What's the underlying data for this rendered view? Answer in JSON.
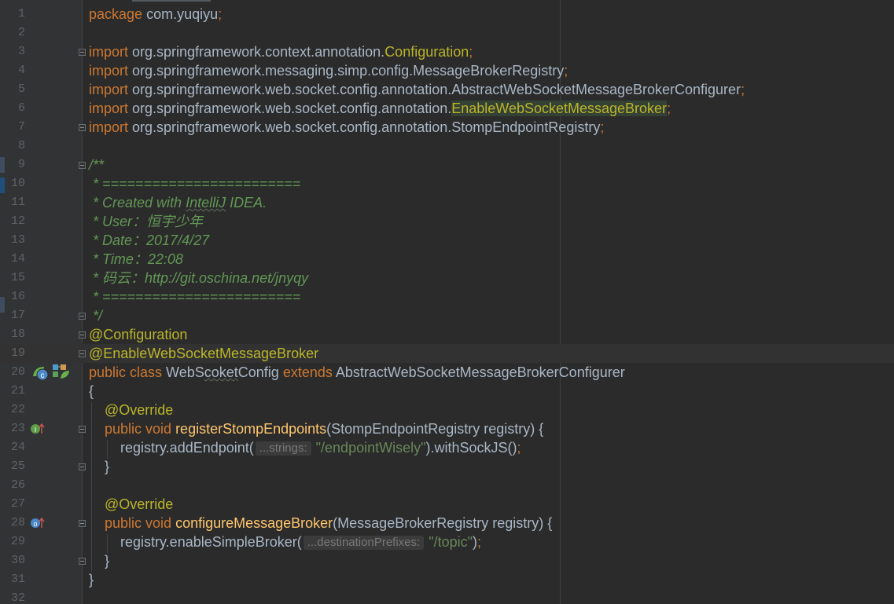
{
  "editor": {
    "lines": [
      {
        "n": "1",
        "tokens": [
          {
            "t": "package",
            "c": "kw"
          },
          {
            "t": " com.yuqiyu",
            "c": "plain"
          },
          {
            "t": ";",
            "c": "semi"
          }
        ]
      },
      {
        "n": "2",
        "tokens": []
      },
      {
        "n": "3",
        "tokens": [
          {
            "t": "import",
            "c": "kw"
          },
          {
            "t": " org.springframework.context.annotation.",
            "c": "plain"
          },
          {
            "t": "Configuration",
            "c": "annimp"
          },
          {
            "t": ";",
            "c": "semi"
          }
        ]
      },
      {
        "n": "4",
        "tokens": [
          {
            "t": "import",
            "c": "kw"
          },
          {
            "t": " org.springframework.messaging.simp.config.MessageBrokerRegistry",
            "c": "plain"
          },
          {
            "t": ";",
            "c": "semi"
          }
        ]
      },
      {
        "n": "5",
        "tokens": [
          {
            "t": "import",
            "c": "kw"
          },
          {
            "t": " org.springframework.web.socket.config.annotation.AbstractWebSocketMessageBrokerConfigurer",
            "c": "plain"
          },
          {
            "t": ";",
            "c": "semi"
          }
        ]
      },
      {
        "n": "6",
        "tokens": [
          {
            "t": "import",
            "c": "kw"
          },
          {
            "t": " org.springframework.web.socket.config.annotation.",
            "c": "plain"
          },
          {
            "t": "EnableWebSocketMessageBroker",
            "c": "annimp hl"
          },
          {
            "t": ";",
            "c": "semi"
          }
        ]
      },
      {
        "n": "7",
        "tokens": [
          {
            "t": "import",
            "c": "kw"
          },
          {
            "t": " org.springframework.web.socket.config.annotation.StompEndpointRegistry",
            "c": "plain"
          },
          {
            "t": ";",
            "c": "semi"
          }
        ]
      },
      {
        "n": "8",
        "tokens": []
      },
      {
        "n": "9",
        "tokens": [
          {
            "t": "/**",
            "c": "doc"
          }
        ]
      },
      {
        "n": "10",
        "tokens": [
          {
            "t": " * ========================",
            "c": "doc"
          }
        ]
      },
      {
        "n": "11",
        "tokens": [
          {
            "t": " * Created with ",
            "c": "doc"
          },
          {
            "t": "IntelliJ",
            "c": "doc typo"
          },
          {
            "t": " IDEA.",
            "c": "doc"
          }
        ]
      },
      {
        "n": "12",
        "tokens": [
          {
            "t": " * User：恒宇少年",
            "c": "doc"
          }
        ]
      },
      {
        "n": "13",
        "tokens": [
          {
            "t": " * Date：2017/4/27",
            "c": "doc"
          }
        ]
      },
      {
        "n": "14",
        "tokens": [
          {
            "t": " * Time：22:08",
            "c": "doc"
          }
        ]
      },
      {
        "n": "15",
        "tokens": [
          {
            "t": " * 码云：http://git.oschina.net/jnyqy",
            "c": "doc"
          }
        ]
      },
      {
        "n": "16",
        "tokens": [
          {
            "t": " * ========================",
            "c": "doc"
          }
        ]
      },
      {
        "n": "17",
        "tokens": [
          {
            "t": " */",
            "c": "doc"
          }
        ]
      },
      {
        "n": "18",
        "tokens": [
          {
            "t": "@Configuration",
            "c": "ann"
          }
        ]
      },
      {
        "n": "19",
        "tokens": [
          {
            "t": "@EnableWebSocketMessageBroker",
            "c": "ann"
          }
        ]
      },
      {
        "n": "20",
        "tokens": [
          {
            "t": "public class ",
            "c": "kw"
          },
          {
            "t": "WebS",
            "c": "plain"
          },
          {
            "t": "coket",
            "c": "plain typo"
          },
          {
            "t": "Config ",
            "c": "plain"
          },
          {
            "t": "extends ",
            "c": "kw"
          },
          {
            "t": "AbstractWebSocketMessageBrokerConfigurer",
            "c": "plain"
          }
        ]
      },
      {
        "n": "21",
        "tokens": [
          {
            "t": "{",
            "c": "plain"
          }
        ]
      },
      {
        "n": "22",
        "tokens": [
          {
            "t": "    @Override",
            "c": "ann"
          }
        ]
      },
      {
        "n": "23",
        "tokens": [
          {
            "t": "    public void ",
            "c": "kw"
          },
          {
            "t": "registerStompEndpoints",
            "c": "fn"
          },
          {
            "t": "(StompEndpointRegistry registry) {",
            "c": "plain"
          }
        ]
      },
      {
        "n": "24",
        "tokens": [
          {
            "t": "        registry.addEndpoint(",
            "c": "plain"
          },
          {
            "t": "...strings:",
            "c": "hint"
          },
          {
            "t": "\"/endpointWisely\"",
            "c": "str"
          },
          {
            "t": ").withSockJS()",
            "c": "plain"
          },
          {
            "t": ";",
            "c": "semi"
          }
        ]
      },
      {
        "n": "25",
        "tokens": [
          {
            "t": "    }",
            "c": "plain"
          }
        ]
      },
      {
        "n": "26",
        "tokens": []
      },
      {
        "n": "27",
        "tokens": [
          {
            "t": "    @Override",
            "c": "ann"
          }
        ]
      },
      {
        "n": "28",
        "tokens": [
          {
            "t": "    public void ",
            "c": "kw"
          },
          {
            "t": "configureMessageBroker",
            "c": "fn"
          },
          {
            "t": "(MessageBrokerRegistry registry) {",
            "c": "plain"
          }
        ]
      },
      {
        "n": "29",
        "tokens": [
          {
            "t": "        registry.enableSimpleBroker(",
            "c": "plain"
          },
          {
            "t": "...destinationPrefixes:",
            "c": "hint"
          },
          {
            "t": "\"/topic\"",
            "c": "str"
          },
          {
            "t": ")",
            "c": "plain"
          },
          {
            "t": ";",
            "c": "semi"
          }
        ]
      },
      {
        "n": "30",
        "tokens": [
          {
            "t": "    }",
            "c": "plain"
          }
        ]
      },
      {
        "n": "31",
        "tokens": [
          {
            "t": "}",
            "c": "plain"
          }
        ]
      },
      {
        "n": "32",
        "tokens": []
      }
    ],
    "gutter_icons": [
      {
        "line": "20",
        "name": "spring-bean-class-icon",
        "color": "#4caf50"
      },
      {
        "line": "20",
        "name": "spring-config-icon",
        "color": "#6a9955"
      },
      {
        "line": "23",
        "name": "implement-method-icon",
        "color": "#6a9955"
      },
      {
        "line": "28",
        "name": "implement-method-icon",
        "color": "#4a88c7"
      }
    ],
    "colors": {
      "background": "#2b2b2b",
      "keyword": "#cc7832",
      "annotation": "#bbb529",
      "doc_comment": "#629755",
      "method": "#ffc66d",
      "string": "#6a8759",
      "text": "#a9b7c6"
    }
  }
}
